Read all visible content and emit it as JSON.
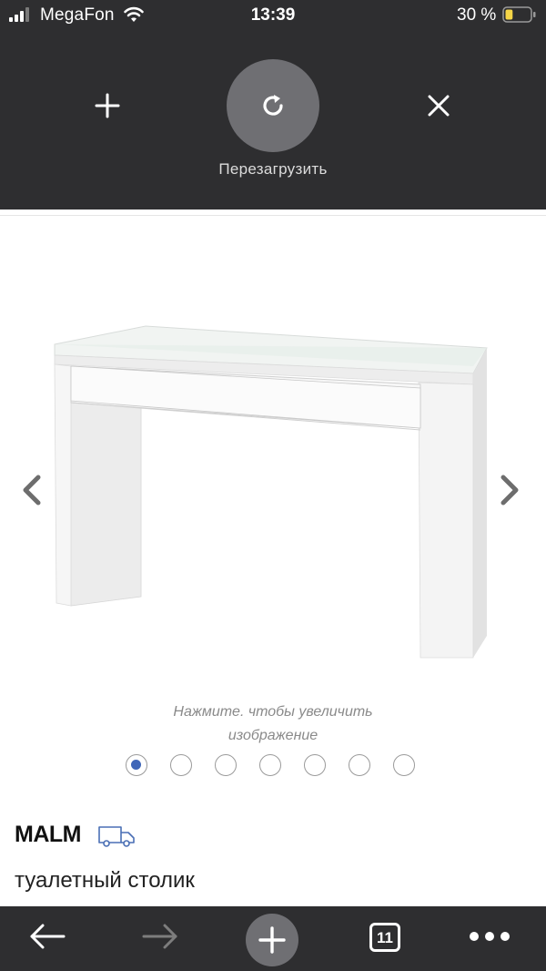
{
  "status_bar": {
    "carrier": "MegaFon",
    "time": "13:39",
    "battery_percent": "30 %",
    "battery_level": 0.3
  },
  "browser_top": {
    "reload_label": "Перезагрузить"
  },
  "product": {
    "hint_line1": "Нажмите. чтобы увеличить",
    "hint_line2": "изображение",
    "name": "MALM",
    "description": "туалетный столик",
    "image_count": 7,
    "active_image_index": 0
  },
  "browser_bottom": {
    "tab_count": "11"
  },
  "colors": {
    "chrome_bg": "#2e2e30",
    "button_bg": "#6f6f73",
    "active_dot": "#3f66b8",
    "truck_icon": "#4a6fb5",
    "battery_fill": "#f5d547"
  }
}
